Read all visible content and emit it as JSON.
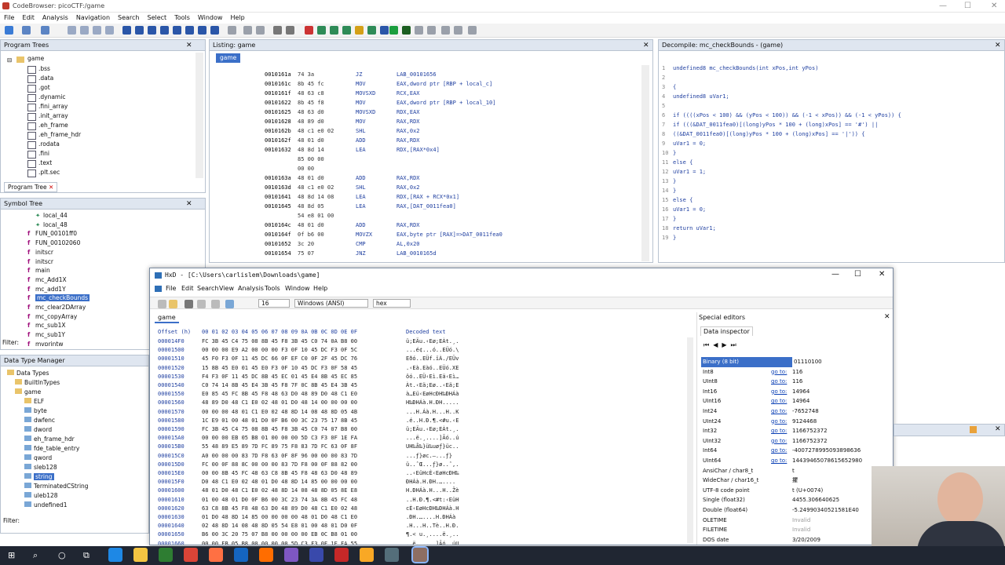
{
  "titlebar": {
    "title": "CodeBrowser: picoCTF:/game"
  },
  "menu": [
    "File",
    "Edit",
    "Analysis",
    "Navigation",
    "Search",
    "Select",
    "Tools",
    "Window",
    "Help"
  ],
  "program_trees": {
    "title": "Program Trees",
    "tab": "game",
    "items": [
      ".bss",
      ".data",
      ".got",
      ".dynamic",
      ".fini_array",
      ".init_array",
      ".eh_frame",
      ".eh_frame_hdr",
      ".rodata",
      ".fini",
      ".text",
      ".plt.sec"
    ],
    "footer_tab": "Program Tree"
  },
  "symbol_tree": {
    "title": "Symbol Tree",
    "items": [
      "local_44",
      "local_48",
      "FUN_00101ff0",
      "FUN_00102060",
      "initscr",
      "initscr",
      "main",
      "mc_Add1X",
      "mc_add1Y",
      "mc_checkBounds",
      "mc_clear2DArray",
      "mc_copyArray",
      "mc_sub1X",
      "mc_sub1Y",
      "mvprintw"
    ],
    "filter_label": "Filter:"
  },
  "data_type_manager": {
    "title": "Data Type Manager",
    "items": [
      "Data Types",
      "BuiltInTypes",
      "game",
      "ELF",
      "byte",
      "dwfenc",
      "dword",
      "eh_frame_hdr",
      "fde_table_entry",
      "qword",
      "sleb128",
      "string",
      "TerminatedCString",
      "uleb128",
      "undefined1"
    ],
    "filter_label": "Filter:"
  },
  "listing": {
    "title": "Listing: game",
    "tab": "game",
    "rows": [
      {
        "addr": "0010161a",
        "bytes": "74 3a",
        "mn": "JZ",
        "op": "LAB_00101656"
      },
      {
        "addr": "0010161c",
        "bytes": "8b 45 fc",
        "mn": "MOV",
        "op": "EAX,dword ptr [RBP + local_c]"
      },
      {
        "addr": "0010161f",
        "bytes": "48 63 c8",
        "mn": "MOVSXD",
        "op": "RCX,EAX"
      },
      {
        "addr": "00101622",
        "bytes": "8b 45 f8",
        "mn": "MOV",
        "op": "EAX,dword ptr [RBP + local_10]"
      },
      {
        "addr": "00101625",
        "bytes": "48 63 d0",
        "mn": "MOVSXD",
        "op": "RDX,EAX"
      },
      {
        "addr": "00101628",
        "bytes": "48 89 d0",
        "mn": "MOV",
        "op": "RAX,RDX"
      },
      {
        "addr": "0010162b",
        "bytes": "48 c1 e0 02",
        "mn": "SHL",
        "op": "RAX,0x2"
      },
      {
        "addr": "0010162f",
        "bytes": "48 01 d0",
        "mn": "ADD",
        "op": "RAX,RDX"
      },
      {
        "addr": "00101632",
        "bytes": "48 8d 14",
        "mn": "LEA",
        "op": "RDX,[RAX*0x4]"
      },
      {
        "addr": "",
        "bytes": "85 00 00",
        "mn": "",
        "op": ""
      },
      {
        "addr": "",
        "bytes": "00 00",
        "mn": "",
        "op": ""
      },
      {
        "addr": "0010163a",
        "bytes": "48 01 d0",
        "mn": "ADD",
        "op": "RAX,RDX"
      },
      {
        "addr": "0010163d",
        "bytes": "48 c1 e0 02",
        "mn": "SHL",
        "op": "RAX,0x2"
      },
      {
        "addr": "00101641",
        "bytes": "48 8d 14 08",
        "mn": "LEA",
        "op": "RDX,[RAX + RCX*0x1]"
      },
      {
        "addr": "00101645",
        "bytes": "48 8d 05",
        "mn": "LEA",
        "op": "RAX,[DAT_0011fea0]"
      },
      {
        "addr": "",
        "bytes": "54 e8 01 00",
        "mn": "",
        "op": ""
      },
      {
        "addr": "0010164c",
        "bytes": "48 01 d0",
        "mn": "ADD",
        "op": "RAX,RDX"
      },
      {
        "addr": "0010164f",
        "bytes": "0f b6 00",
        "mn": "MOVZX",
        "op": "EAX,byte ptr [RAX]=>DAT_0011fea0"
      },
      {
        "addr": "00101652",
        "bytes": "3c 20",
        "mn": "CMP",
        "op": "AL,0x20"
      },
      {
        "addr": "00101654",
        "bytes": "75 07",
        "mn": "JNZ",
        "op": "LAB_0010165d"
      }
    ]
  },
  "decompile": {
    "title": "Decompile: mc_checkBounds - (game)",
    "lines": [
      "undefined8 mc_checkBounds(int xPos,int yPos)",
      "",
      "{",
      "  undefined8 uVar1;",
      "",
      "  if ((((xPos < 100) && (yPos < 100)) && (-1 < xPos)) && (-1 < yPos)) {",
      "    if (((&DAT_0011fea0)[(long)yPos * 100 + (long)xPos] == '#') ||",
      "       ((&DAT_0011fea0)[(long)yPos * 100 + (long)xPos] == '|')) {",
      "      uVar1 = 0;",
      "    }",
      "    else {",
      "      uVar1 = 1;",
      "    }",
      "  }",
      "  else {",
      "    uVar1 = 0;",
      "  }",
      "  return uVar1;",
      "}"
    ]
  },
  "hxd": {
    "title": "HxD - [C:\\Users\\carlislem\\Downloads\\game]",
    "menu": [
      "File",
      "Edit",
      "Search",
      "View",
      "Analysis",
      "Tools",
      "Window",
      "Help"
    ],
    "bytes_per_row": "16",
    "charset": "Windows (ANSI)",
    "mode": "hex",
    "tab": "game",
    "header_offset": "Offset (h)",
    "header_cols": "00 01 02 03 04 05 06 07 08 09 0A 0B 0C 0D 0E 0F",
    "header_decoded": "Decoded text",
    "rows": [
      {
        "off": "000014F0",
        "hex": "FC 3B 45 C4 75 08 8B 45 F8 3B 45 C0 74 0A B8 00",
        "txt": "ü;EÄu.‹Eø;EÀt.¸."
      },
      {
        "off": "00001500",
        "hex": "00 00 00 E9 A2 00 00 00 F3 0F 10 45 DC F3 0F 5C",
        "txt": "...é¢...ó..EÜó.\\"
      },
      {
        "off": "00001510",
        "hex": "45 F0 F3 0F 11 45 DC 66 0F EF C0 0F 2F 45 DC 76",
        "txt": "Eðó..EÜf.ïÀ./EÜv"
      },
      {
        "off": "00001520",
        "hex": "15 8B 45 E0 01 45 E0 F3 0F 10 45 DC F3 0F 58 45",
        "txt": ".‹Eà.Eàó..EÜó.XE"
      },
      {
        "off": "00001530",
        "hex": "F4 F3 0F 11 45 DC 8B 45 EC 01 45 E4 8B 45 EC 85",
        "txt": "ôó..EÜ‹Eì.Eä‹Eì…"
      },
      {
        "off": "00001540",
        "hex": "C0 74 14 8B 45 E4 3B 45 F8 7F 0C 8B 45 E4 3B 45",
        "txt": "Àt.‹Eä;Eø..‹Eä;E"
      },
      {
        "off": "00001550",
        "hex": "E0 85 45 FC 8B 45 F8 48 63 D0 48 89 D0 48 C1 E0",
        "txt": "à…Eü‹EøHcÐH‰ÐHÁà"
      },
      {
        "off": "00001560",
        "hex": "48 89 D0 48 C1 E0 02 48 01 D0 48 14 00 00 00 00",
        "txt": "H‰ÐHÁà.H.ÐH....."
      },
      {
        "off": "00001570",
        "hex": "00 00 00 48 01 C1 E0 02 48 8D 14 08 48 8D 05 4B",
        "txt": "...H.Áà.H...H..K"
      },
      {
        "off": "00001580",
        "hex": "1C E9 01 00 48 01 D0 0F B6 00 3C 23 75 17 8B 45",
        "txt": ".é..H.Ð.¶.<#u.‹E"
      },
      {
        "off": "00001590",
        "hex": "FC 3B 45 C4 75 08 8B 45 F8 3B 45 C0 74 07 B8 00",
        "txt": "ü;EÄu.‹Eø;EÀt.¸."
      },
      {
        "off": "000015A0",
        "hex": "00 00 00 EB 05 B8 01 00 00 00 5D C3 F3 0F 1E FA",
        "txt": "...ë.¸....]Ãó..ú"
      },
      {
        "off": "000015B0",
        "hex": "55 48 89 E5 89 7D FC 89 75 F8 83 7D FC 63 0F 8F",
        "txt": "UH‰å‰}ü‰uøƒ}üc.."
      },
      {
        "off": "000015C0",
        "hex": "A0 00 00 00 83 7D F8 63 0F 8F 96 00 00 00 83 7D",
        "txt": " ...ƒ}øc.–...ƒ}"
      },
      {
        "off": "000015D0",
        "hex": "FC 00 0F 88 8C 00 00 00 83 7D F8 00 0F 88 82 00",
        "txt": "ü..ˆŒ...ƒ}ø..ˆ‚."
      },
      {
        "off": "000015E0",
        "hex": "00 00 8B 45 FC 48 63 C8 8B 45 F8 48 63 D0 48 89",
        "txt": "..‹EüHcÈ‹EøHcÐH‰"
      },
      {
        "off": "000015F0",
        "hex": "D0 48 C1 E0 02 48 01 D0 48 8D 14 85 00 00 00 00",
        "txt": "ÐHÁà.H.ÐH.…...."
      },
      {
        "off": "00001600",
        "hex": "48 01 D0 48 C1 E0 02 48 8D 14 08 48 8D 05 8E E8",
        "txt": "H.ÐHÁà.H...H..Žè"
      },
      {
        "off": "00001610",
        "hex": "01 00 48 01 D0 0F B6 00 3C 23 74 3A 8B 45 FC 48",
        "txt": "..H.Ð.¶.<#t:‹EüH"
      },
      {
        "off": "00001620",
        "hex": "63 C8 8B 45 F8 48 63 D0 48 89 D0 48 C1 E0 02 48",
        "txt": "cÈ‹EøHcÐH‰ÐHÁà.H"
      },
      {
        "off": "00001630",
        "hex": "01 D0 48 8D 14 85 00 00 00 00 48 01 D0 48 C1 E0",
        "txt": ".ÐH.…....H.ÐHÁà"
      },
      {
        "off": "00001640",
        "hex": "02 48 8D 14 08 48 8D 05 54 E8 01 00 48 01 D0 0F",
        "txt": ".H...H..Tè..H.Ð."
      },
      {
        "off": "00001650",
        "hex": "B6 00 3C 20 75 07 B8 00 00 00 00 EB 0C B8 01 00",
        "txt": "¶.< u.¸....ë.¸.."
      },
      {
        "off": "00001660",
        "hex": "00 00 EB 05 B8 00 00 00 00 5D C3 F3 0F 1E FA 55",
        "txt": "..ë.¸....]Ãó..úU"
      }
    ]
  },
  "special_editors": {
    "title": "Special editors",
    "tab": "Data inspector",
    "rows": [
      {
        "k": "Binary (8 bit)",
        "g": "",
        "v": "01110100"
      },
      {
        "k": "Int8",
        "g": "go to:",
        "v": "116"
      },
      {
        "k": "UInt8",
        "g": "go to:",
        "v": "116"
      },
      {
        "k": "Int16",
        "g": "go to:",
        "v": "14964"
      },
      {
        "k": "UInt16",
        "g": "go to:",
        "v": "14964"
      },
      {
        "k": "Int24",
        "g": "go to:",
        "v": "-7652748"
      },
      {
        "k": "UInt24",
        "g": "go to:",
        "v": "9124468"
      },
      {
        "k": "Int32",
        "g": "go to:",
        "v": "1166752372"
      },
      {
        "k": "UInt32",
        "g": "go to:",
        "v": "1166752372"
      },
      {
        "k": "Int64",
        "g": "go to:",
        "v": "-4007278995093898636"
      },
      {
        "k": "UInt64",
        "g": "go to:",
        "v": "14439465078615652980"
      },
      {
        "k": "AnsiChar / char8_t",
        "g": "",
        "v": "t"
      },
      {
        "k": "WideChar / char16_t",
        "g": "",
        "v": "㩴"
      },
      {
        "k": "UTF-8 code point",
        "g": "",
        "v": "t (U+0074)"
      },
      {
        "k": "Single (float32)",
        "g": "",
        "v": "4455.306640625"
      },
      {
        "k": "Double (float64)",
        "g": "",
        "v": "-5.24990340521581E40"
      },
      {
        "k": "OLETIME",
        "g": "",
        "v": "Invalid"
      },
      {
        "k": "FILETIME",
        "g": "",
        "v": "Invalid"
      },
      {
        "k": "DOS date",
        "g": "",
        "v": "3/20/2009"
      }
    ]
  },
  "colors": {
    "selection": "#3b6fc8",
    "accent": "#a0107c",
    "listing_addr": "#000000",
    "listing_op": "#1f3fa0"
  }
}
